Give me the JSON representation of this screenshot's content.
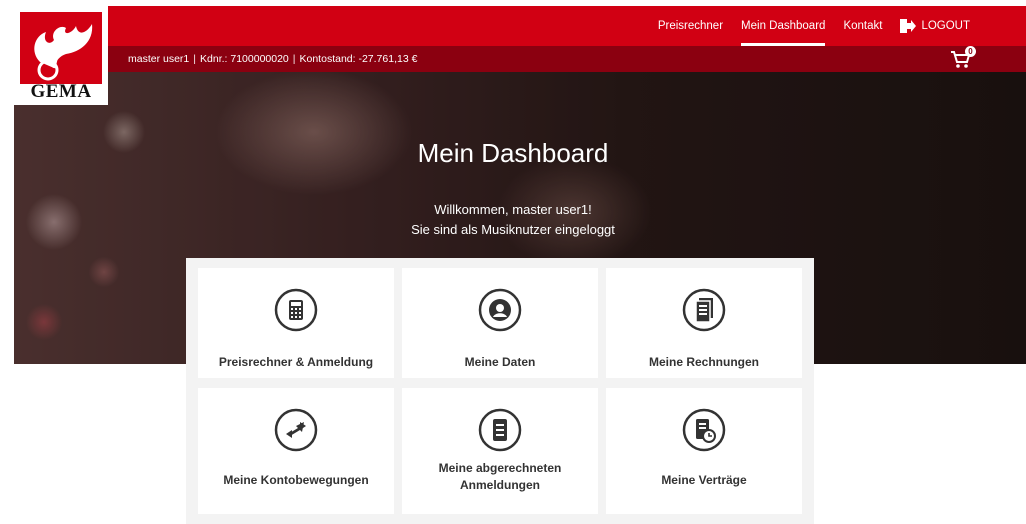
{
  "brand": {
    "logo_text": "GEMA"
  },
  "nav": {
    "items": [
      {
        "label": "Preisrechner",
        "active": false
      },
      {
        "label": "Mein Dashboard",
        "active": true
      },
      {
        "label": "Kontakt",
        "active": false
      }
    ],
    "logout_label": "LOGOUT"
  },
  "user_bar": {
    "user": "master user1",
    "customer_no": "Kdnr.: 7100000020",
    "balance": "Kontostand: -27.761,13 €",
    "separator": "|",
    "cart_count": "0"
  },
  "hero": {
    "title": "Mein Dashboard",
    "welcome": "Willkommen, master user1!",
    "status": "Sie sind als Musiknutzer eingeloggt"
  },
  "tiles": [
    {
      "label": "Preisrechner & Anmeldung",
      "icon": "calculator-icon"
    },
    {
      "label": "Meine Daten",
      "icon": "user-icon"
    },
    {
      "label": "Meine Rechnungen",
      "icon": "invoice-icon"
    },
    {
      "label": "Meine Kontobewegungen",
      "icon": "transfer-arrows-icon"
    },
    {
      "label": "Meine abgerechneten Anmeldungen",
      "icon": "document-list-icon"
    },
    {
      "label": "Meine Verträge",
      "icon": "contract-icon"
    }
  ],
  "colors": {
    "primary_red": "#d10013",
    "dark_red": "#8b0010",
    "text": "#333333"
  }
}
